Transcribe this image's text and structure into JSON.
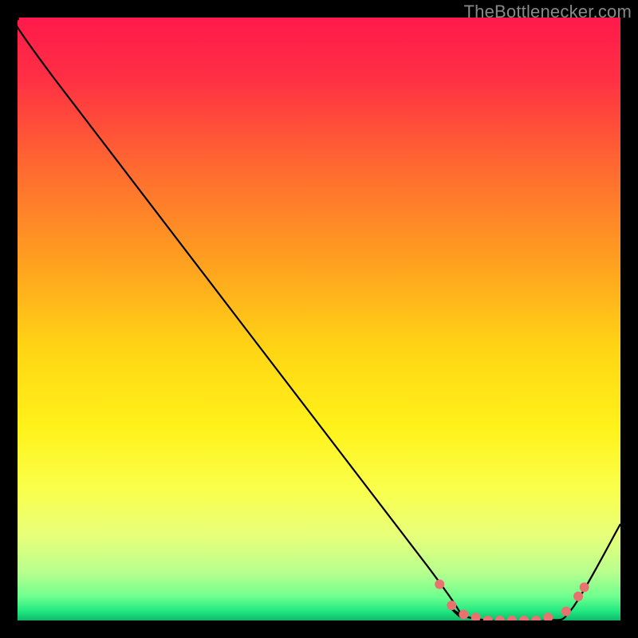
{
  "watermark": "TheBottlenecker.com",
  "chart_data": {
    "type": "line",
    "title": "",
    "xlabel": "",
    "ylabel": "",
    "xlim": [
      0,
      100
    ],
    "ylim": [
      0,
      100
    ],
    "curve": [
      {
        "x": 0,
        "y": 100
      },
      {
        "x": 6,
        "y": 90
      },
      {
        "x": 68,
        "y": 9
      },
      {
        "x": 72,
        "y": 2
      },
      {
        "x": 78,
        "y": 0
      },
      {
        "x": 88,
        "y": 0
      },
      {
        "x": 92,
        "y": 2
      },
      {
        "x": 100,
        "y": 16
      }
    ],
    "markers": [
      {
        "x": 70,
        "y": 6
      },
      {
        "x": 72,
        "y": 2.5
      },
      {
        "x": 74,
        "y": 1
      },
      {
        "x": 76,
        "y": 0.5
      },
      {
        "x": 78,
        "y": 0
      },
      {
        "x": 80,
        "y": 0
      },
      {
        "x": 82,
        "y": 0
      },
      {
        "x": 84,
        "y": 0
      },
      {
        "x": 86,
        "y": 0
      },
      {
        "x": 88,
        "y": 0.5
      },
      {
        "x": 91,
        "y": 1.5
      },
      {
        "x": 93,
        "y": 4
      },
      {
        "x": 94,
        "y": 5.5
      }
    ],
    "gradient_stops": [
      {
        "offset": 0.0,
        "color": "#ff1a4b"
      },
      {
        "offset": 0.1,
        "color": "#ff2f44"
      },
      {
        "offset": 0.25,
        "color": "#ff6a30"
      },
      {
        "offset": 0.4,
        "color": "#ff9e20"
      },
      {
        "offset": 0.55,
        "color": "#ffd514"
      },
      {
        "offset": 0.68,
        "color": "#fff21a"
      },
      {
        "offset": 0.78,
        "color": "#faff4a"
      },
      {
        "offset": 0.86,
        "color": "#e7ff7a"
      },
      {
        "offset": 0.92,
        "color": "#b8ff8e"
      },
      {
        "offset": 0.96,
        "color": "#6fff8f"
      },
      {
        "offset": 0.985,
        "color": "#20e880"
      },
      {
        "offset": 1.0,
        "color": "#0fb86a"
      }
    ],
    "marker_color": "#e9716f",
    "line_color": "#000000"
  }
}
